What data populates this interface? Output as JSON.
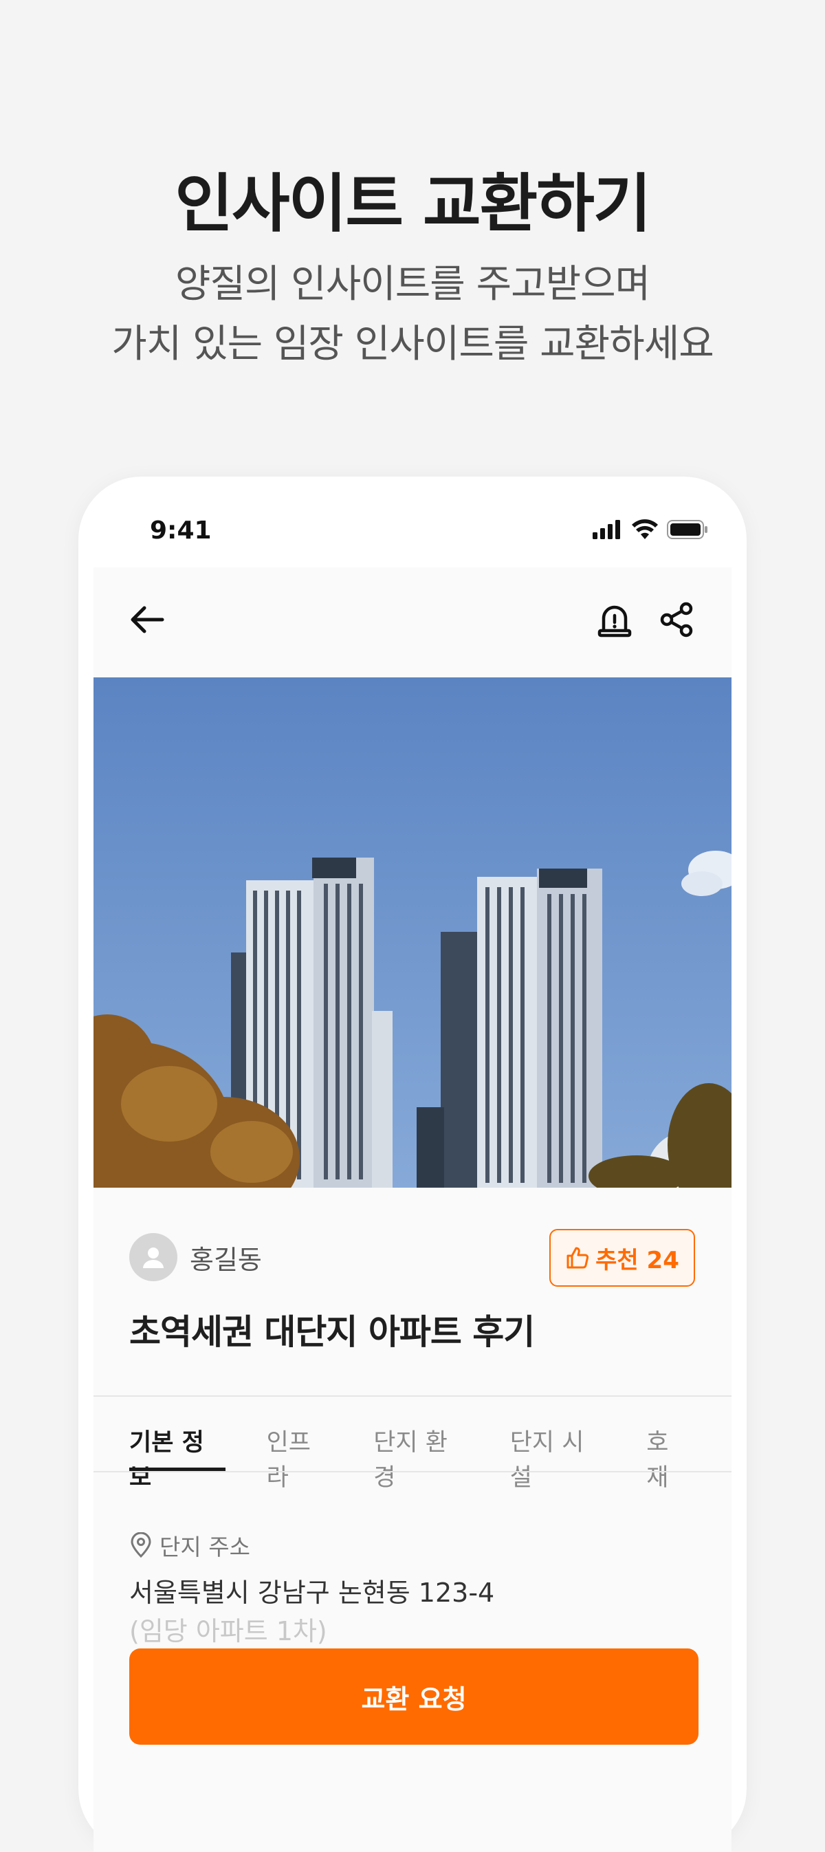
{
  "promo": {
    "headline": "인사이트 교환하기",
    "subline_1": "양질의 인사이트를 주고받으며",
    "subline_2": "가치 있는 임장 인사이트를 교환하세요"
  },
  "status_bar": {
    "time": "9:41"
  },
  "nav": {
    "back_icon": "arrow-left-icon",
    "report_icon": "siren-icon",
    "share_icon": "share-icon"
  },
  "post": {
    "author": "홍길동",
    "recommend_label": "추천 24",
    "title": "초역세권 대단지 아파트 후기"
  },
  "tabs": [
    {
      "label": "기본 정보",
      "active": true
    },
    {
      "label": "인프라",
      "active": false
    },
    {
      "label": "단지 환경",
      "active": false
    },
    {
      "label": "단지 시설",
      "active": false
    },
    {
      "label": "호재",
      "active": false
    }
  ],
  "address": {
    "label": "단지 주소",
    "main": "서울특별시 강남구 논현동  123-4",
    "sub": "(임당 아파트 1차)"
  },
  "cta": {
    "label": "교환 요청"
  },
  "colors": {
    "accent": "#ff6b00",
    "background": "#f4f4f4"
  }
}
